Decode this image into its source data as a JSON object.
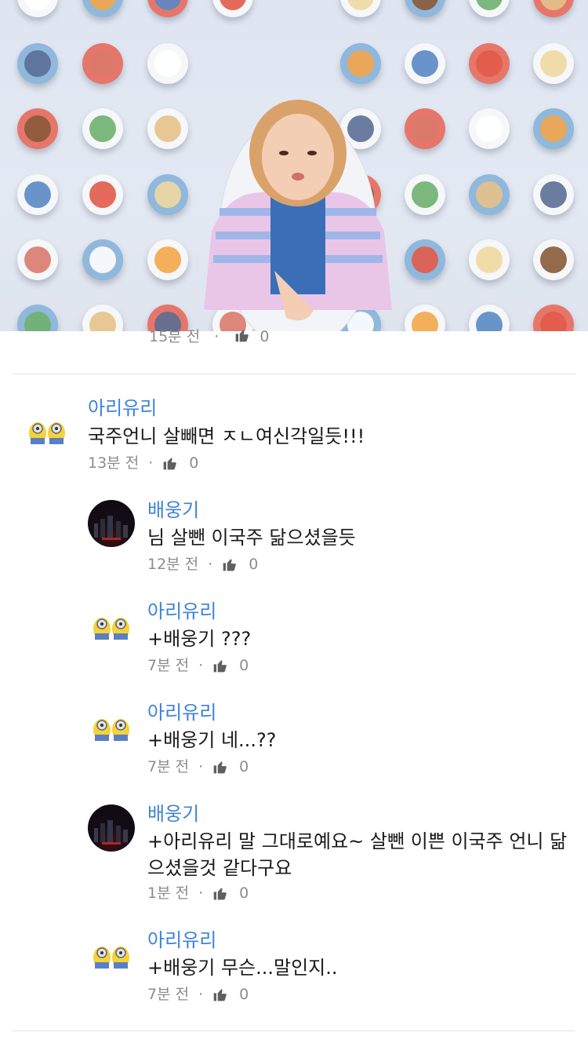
{
  "video": {
    "plate_colors": [
      "#ffffff",
      "#f3a64a",
      "#5a88c4",
      "#e25b4a",
      "#f0d8a0",
      "#8a5a3a",
      "#6fb06f",
      "#e6c28a",
      "#5b6e96",
      "#d97a6b"
    ]
  },
  "thread": {
    "parent_meta": {
      "time": "15분 전",
      "likes": "0"
    },
    "comment": {
      "author": "아리유리",
      "text": "국주언니 살빼면 ㅈㄴ여신각일듯!!!",
      "time": "13분 전",
      "likes": "0"
    },
    "replies": [
      {
        "author": "배웅기",
        "text": "님 살뺀 이국주 닮으셨을듯",
        "time": "12분 전",
        "likes": "0"
      },
      {
        "author": "아리유리",
        "text": "+배웅기 ???",
        "time": "7분 전",
        "likes": "0"
      },
      {
        "author": "아리유리",
        "text": "+배웅기 네...??",
        "time": "7분 전",
        "likes": "0"
      },
      {
        "author": "배웅기",
        "text_line1": "+아리유리 말 그대로예요~ 살뺀 이쁜 이국주 언니 닮",
        "text_line2": "으셨을것 같다구요",
        "time": "1분 전",
        "likes": "0"
      },
      {
        "author": "아리유리",
        "text": "+배웅기 무슨...말인지..",
        "time": "7분 전",
        "likes": "0"
      }
    ],
    "separator_dot": "·"
  }
}
